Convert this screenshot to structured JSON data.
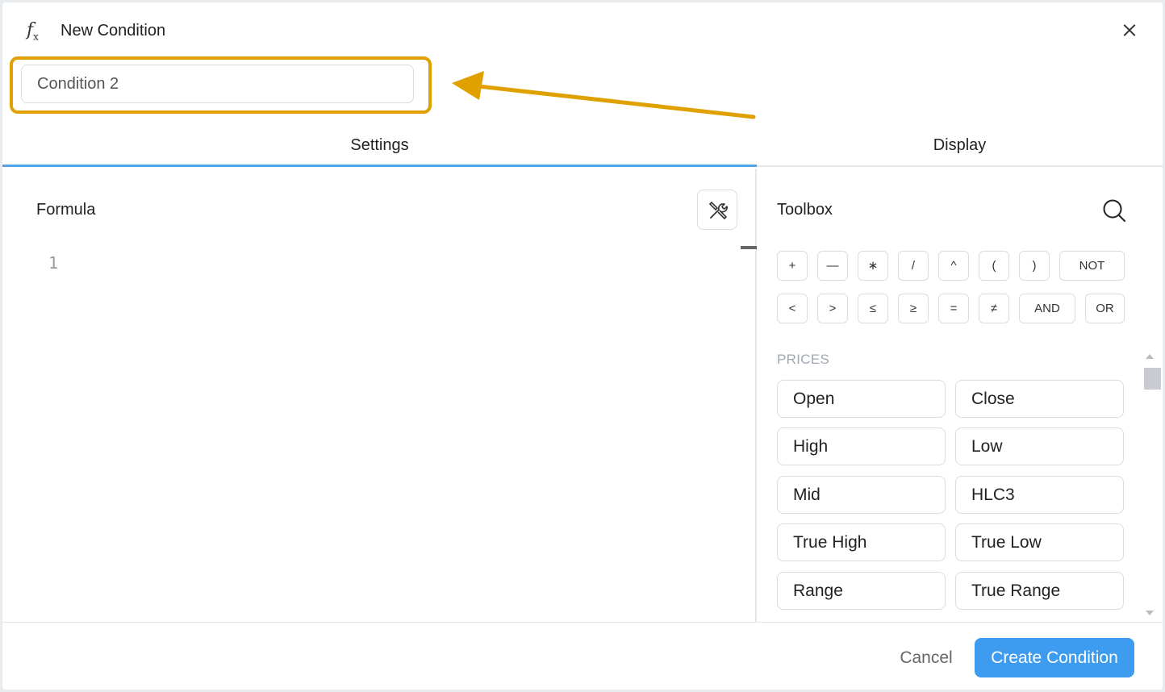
{
  "header": {
    "icon": "function-icon",
    "title": "New Condition",
    "close_icon": "close-icon"
  },
  "name_input": {
    "value": "Condition 2"
  },
  "annotation": {
    "color": "#e0a000"
  },
  "tabs": [
    {
      "label": "Settings",
      "active": true
    },
    {
      "label": "Display",
      "active": false
    }
  ],
  "formula": {
    "label": "Formula",
    "tools_icon": "tools-icon",
    "line_numbers": [
      "1"
    ]
  },
  "toolbox": {
    "label": "Toolbox",
    "search_icon": "search-icon",
    "operators_row1": [
      "+",
      "—",
      "∗",
      "/",
      "^",
      "(",
      ")",
      "NOT"
    ],
    "operators_row2": [
      "<",
      ">",
      "≤",
      "≥",
      "=",
      "≠",
      "AND",
      "OR"
    ],
    "section_label": "PRICES",
    "prices": [
      "Open",
      "Close",
      "High",
      "Low",
      "Mid",
      "HLC3",
      "True High",
      "True Low",
      "Range",
      "True Range"
    ]
  },
  "footer": {
    "cancel_label": "Cancel",
    "create_label": "Create Condition"
  },
  "colors": {
    "accent": "#3d9bf0",
    "tab_indicator": "#4ea3ea",
    "annotation": "#e0a000"
  }
}
